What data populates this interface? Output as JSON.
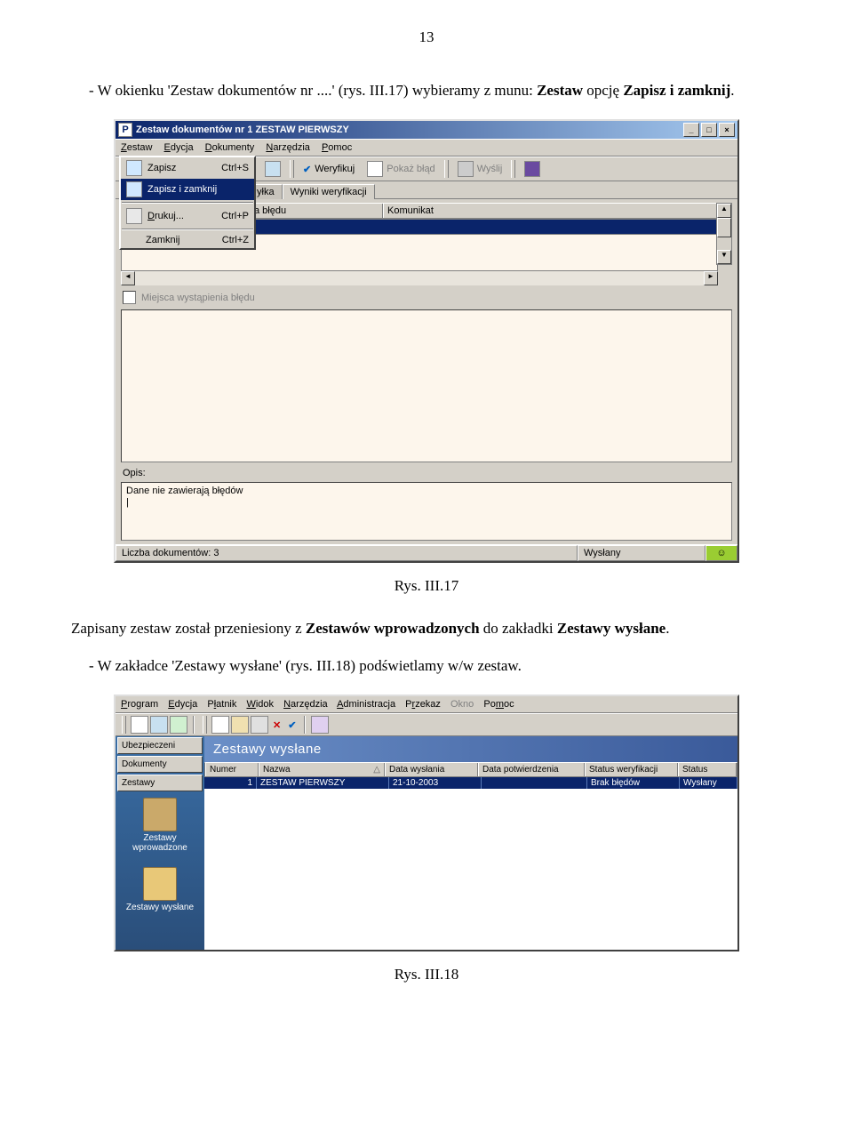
{
  "page_number": "13",
  "para1": {
    "prefix": "-   W okienku 'Zestaw dokumentów nr ....' (rys. III.17) wybieramy z munu: ",
    "bold1": "Zestaw",
    "mid": " opcję ",
    "bold2": "Zapisz i zamknij",
    "suffix": "."
  },
  "caption1": "Rys. III.17",
  "para2": {
    "prefix": "Zapisany zestaw został przeniesiony z ",
    "bold1": "Zestawów wprowadzonych",
    "mid": " do zakładki ",
    "bold2": "Zestawy wysłane",
    "suffix": "."
  },
  "para3": "-   W zakładce 'Zestawy wysłane' (rys. III.18) podświetlamy w/w zestaw.",
  "caption2": "Rys. III.18",
  "win1": {
    "title": "Zestaw dokumentów nr 1 ZESTAW PIERWSZY",
    "menus": {
      "m1": "Zestaw",
      "m2": "Edycja",
      "m3": "Dokumenty",
      "m4": "Narzędzia",
      "m5": "Pomoc"
    },
    "file_menu": {
      "save": "Zapisz",
      "save_sc": "Ctrl+S",
      "save_close": "Zapisz i zamknij",
      "print": "Drukuj...",
      "print_sc": "Ctrl+P",
      "close": "Zamknij",
      "close_sc": "Ctrl+Z"
    },
    "toolbar": {
      "verify": "Weryfikuj",
      "show_error": "Pokaż błąd",
      "send": "Wyślij"
    },
    "tabs": {
      "t1": "yłka",
      "t2": "Wyniki weryfikacji"
    },
    "grid": {
      "col_err": "a błędu",
      "col_msg": "Komunikat"
    },
    "chk_label": "Miejsca wystąpienia błędu",
    "opis_label": "Opis:",
    "opis_text": "Dane nie zawierają błędów",
    "status_docs": "Liczba dokumentów: 3",
    "status_sent": "Wysłany"
  },
  "win2": {
    "menus": {
      "m1": "Program",
      "m2": "Edycja",
      "m3": "Płatnik",
      "m4": "Widok",
      "m5": "Narzędzia",
      "m6": "Administracja",
      "m7": "Przekaz",
      "m8": "Okno",
      "m9": "Pomoc"
    },
    "side": {
      "b1": "Ubezpieczeni",
      "b2": "Dokumenty",
      "b3": "Zestawy",
      "i1": "Zestawy wprowadzone",
      "i2": "Zestawy wysłane"
    },
    "banner": "Zestawy wysłane",
    "cols": {
      "num": "Numer",
      "name": "Nazwa",
      "sort": "△",
      "d1": "Data wysłania",
      "d2": "Data potwierdzenia",
      "sw": "Status weryfikacji",
      "st": "Status"
    },
    "row": {
      "num": "1",
      "name": "ZESTAW PIERWSZY",
      "d1": "21-10-2003",
      "d2": "",
      "sw": "Brak błędów",
      "st": "Wysłany"
    }
  }
}
